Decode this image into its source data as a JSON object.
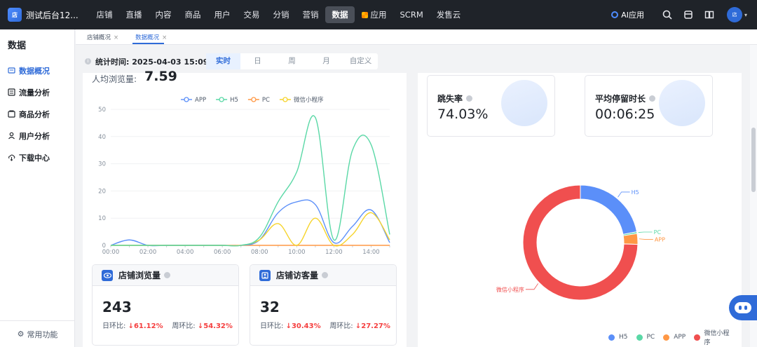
{
  "app": {
    "brand_name": "测试后台12...",
    "logo_text": "店"
  },
  "nav": {
    "items": [
      "店铺",
      "直播",
      "内容",
      "商品",
      "用户",
      "交易",
      "分销",
      "营销",
      "数据",
      "应用",
      "SCRM",
      "发售云"
    ],
    "active": "数据"
  },
  "topbar": {
    "ai_label": "AI应用",
    "avatar_text": "店"
  },
  "sidebar": {
    "title": "数据",
    "items": [
      {
        "label": "数据概况",
        "icon": "overview-icon",
        "active": true
      },
      {
        "label": "流量分析",
        "icon": "traffic-icon",
        "active": false
      },
      {
        "label": "商品分析",
        "icon": "goods-icon",
        "active": false
      },
      {
        "label": "用户分析",
        "icon": "user-icon",
        "active": false
      },
      {
        "label": "下载中心",
        "icon": "download-icon",
        "active": false
      }
    ],
    "footer_label": "常用功能"
  },
  "tabs": [
    {
      "label": "店铺概况",
      "active": false
    },
    {
      "label": "数据概况",
      "active": true
    }
  ],
  "timebar": {
    "label": "统计时间: 2025-04-03 15:09:27",
    "segments": [
      "实时",
      "日",
      "周",
      "月",
      "自定义"
    ],
    "active_segment": "实时"
  },
  "page_views": {
    "label": "人均浏览量:",
    "value": "7.59"
  },
  "cards": {
    "browse": {
      "title": "店铺浏览量",
      "value": "243",
      "day_label": "日环比:",
      "day_value": "↓61.12%",
      "week_label": "周环比:",
      "week_value": "↓54.32%"
    },
    "visitors": {
      "title": "店铺访客量",
      "value": "32",
      "day_label": "日环比:",
      "day_value": "↓30.43%",
      "week_label": "周环比:",
      "week_value": "↓27.27%"
    }
  },
  "kpis": {
    "bounce": {
      "title": "跳失率",
      "value": "74.03%"
    },
    "stay": {
      "title": "平均停留时长",
      "value": "00:06:25"
    }
  },
  "chart_data": [
    {
      "type": "line",
      "x": [
        "00:00",
        "01:00",
        "02:00",
        "03:00",
        "04:00",
        "05:00",
        "06:00",
        "07:00",
        "08:00",
        "09:00",
        "10:00",
        "11:00",
        "12:00",
        "13:00",
        "14:00",
        "15:00"
      ],
      "x_ticks": [
        "00:00",
        "02:00",
        "04:00",
        "06:00",
        "08:00",
        "10:00",
        "12:00",
        "14:00"
      ],
      "y_ticks": [
        0,
        10,
        20,
        30,
        40,
        50
      ],
      "ylim": [
        0,
        50
      ],
      "series": [
        {
          "name": "APP",
          "color": "#5b8ff9",
          "values": [
            0,
            2,
            0,
            0,
            0,
            0,
            0,
            0,
            2,
            12,
            16,
            15,
            1,
            7,
            13,
            1
          ]
        },
        {
          "name": "H5",
          "color": "#5ad8a6",
          "values": [
            0,
            0,
            0,
            0,
            0,
            0,
            0,
            0,
            3,
            16,
            27,
            47,
            2,
            35,
            37,
            4
          ]
        },
        {
          "name": "PC",
          "color": "#ff9845",
          "values": [
            0,
            0,
            0,
            0,
            0,
            0,
            0,
            0,
            0,
            0,
            0,
            0,
            0,
            0,
            0,
            0
          ]
        },
        {
          "name": "微信小程序",
          "color": "#f6d42b",
          "values": [
            0,
            0,
            0,
            0,
            0,
            0,
            0,
            0,
            2,
            8,
            0,
            10,
            0,
            4,
            12,
            2
          ]
        }
      ]
    },
    {
      "type": "pie",
      "categories": [
        "H5",
        "PC",
        "APP",
        "微信小程序"
      ],
      "values": [
        22,
        0.5,
        3,
        74.5
      ],
      "colors": [
        "#5b8ff9",
        "#5ad8a6",
        "#ff9845",
        "#f04f4f"
      ]
    }
  ]
}
